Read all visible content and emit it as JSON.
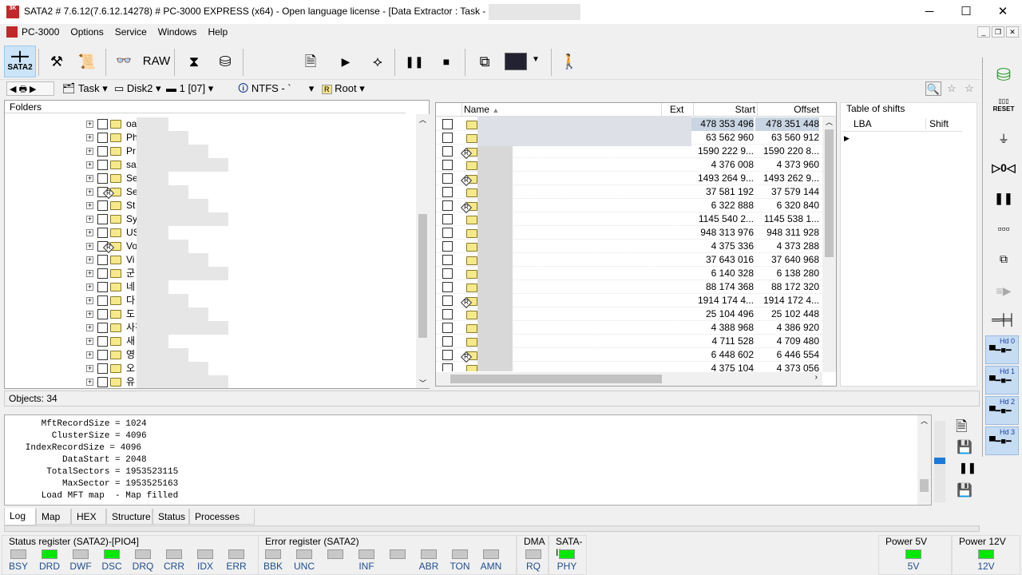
{
  "window": {
    "title": "SATA2 # 7.6.12(7.6.12.14278) # PC-3000 EXPRESS (x64) - Open language license - [Data Extractor : Task - ",
    "minimize": "─",
    "maximize": "☐",
    "close": "✕"
  },
  "menu": [
    "PC-3000",
    "Options",
    "Service",
    "Windows",
    "Help"
  ],
  "toolbar": {
    "sata2": "SATA2",
    "raw": "RAW"
  },
  "navbar": {
    "task": "Task",
    "disk": "Disk2",
    "partition": "1 [07]",
    "fs": "NTFS - `",
    "root": "Root"
  },
  "folders": {
    "header": "Folders",
    "items": [
      "oa",
      "Photo",
      "Pr",
      "sa",
      "Se",
      "Se",
      "St",
      "Sy",
      "US",
      "Vo",
      "Vi",
      "군",
      "네",
      "다",
      "도",
      "사진",
      "새",
      "영",
      "오",
      "유"
    ],
    "reparse": [
      5,
      9
    ]
  },
  "files": {
    "columns": {
      "name": "Name",
      "ext": "Ext",
      "start": "Start",
      "offset": "Offset"
    },
    "rows": [
      [
        "478 353 496",
        "478 351 448"
      ],
      [
        "63 562 960",
        "63 560 912"
      ],
      [
        "1590 222 9...",
        "1590 220 8..."
      ],
      [
        "4 376 008",
        "4 373 960"
      ],
      [
        "1493 264 9...",
        "1493 262 9..."
      ],
      [
        "37 581 192",
        "37 579 144"
      ],
      [
        "6 322 888",
        "6 320 840"
      ],
      [
        "1145 540 2...",
        "1145 538 1..."
      ],
      [
        "948 313 976",
        "948 311 928"
      ],
      [
        "4 375 336",
        "4 373 288"
      ],
      [
        "37 643 016",
        "37 640 968"
      ],
      [
        "6 140 328",
        "6 138 280"
      ],
      [
        "88 174 368",
        "88 172 320"
      ],
      [
        "1914 174 4...",
        "1914 172 4..."
      ],
      [
        "25 104 496",
        "25 102 448"
      ],
      [
        "4 388 968",
        "4 386 920"
      ],
      [
        "4 711 528",
        "4 709 480"
      ],
      [
        "6 448 602",
        "6 446 554"
      ],
      [
        "4 375 104",
        "4 373 056"
      ]
    ],
    "reparse": [
      2,
      4,
      6,
      13,
      17
    ],
    "selected": 0
  },
  "shifts": {
    "title": "Table of shifts",
    "lba": "LBA",
    "shift": "Shift"
  },
  "status_objects": "Objects: 34",
  "log": [
    "      MftRecordSize = 1024",
    "        ClusterSize = 4096",
    "   IndexRecordSize = 4096",
    "          DataStart = 2048",
    "       TotalSectors = 1953523115",
    "          MaxSector = 1953525163",
    "      Load MFT map  - Map filled"
  ],
  "tabs": [
    "Log",
    "Map",
    "HEX",
    "Structure",
    "Status",
    "Processes"
  ],
  "status_register": {
    "title": "Status register (SATA2)-[PIO4]",
    "leds": [
      {
        "l": "BSY",
        "on": false
      },
      {
        "l": "DRD",
        "on": true
      },
      {
        "l": "DWF",
        "on": false
      },
      {
        "l": "DSC",
        "on": true
      },
      {
        "l": "DRQ",
        "on": false
      },
      {
        "l": "CRR",
        "on": false
      },
      {
        "l": "IDX",
        "on": false
      },
      {
        "l": "ERR",
        "on": false
      }
    ]
  },
  "error_register": {
    "title": "Error register (SATA2)",
    "leds": [
      {
        "l": "BBK",
        "on": false
      },
      {
        "l": "UNC",
        "on": false
      },
      {
        "l": "",
        "on": false
      },
      {
        "l": "INF",
        "on": false
      },
      {
        "l": "",
        "on": false
      },
      {
        "l": "ABR",
        "on": false
      },
      {
        "l": "TON",
        "on": false
      },
      {
        "l": "AMN",
        "on": false
      }
    ]
  },
  "dma": {
    "title": "DMA",
    "label": "RQ"
  },
  "sata": {
    "title": "SATA-II",
    "label": "PHY"
  },
  "power5": {
    "title": "Power 5V",
    "label": "5V"
  },
  "power12": {
    "title": "Power 12V",
    "label": "12V"
  },
  "right_tools": {
    "reset": "RESET",
    "hd": [
      "Hd 0",
      "Hd 1",
      "Hd 2",
      "Hd 3"
    ]
  },
  "colors": {
    "led_on": "#00e800",
    "selected_row": "#c9d5e3",
    "hd_button": "#c6dcf3"
  }
}
